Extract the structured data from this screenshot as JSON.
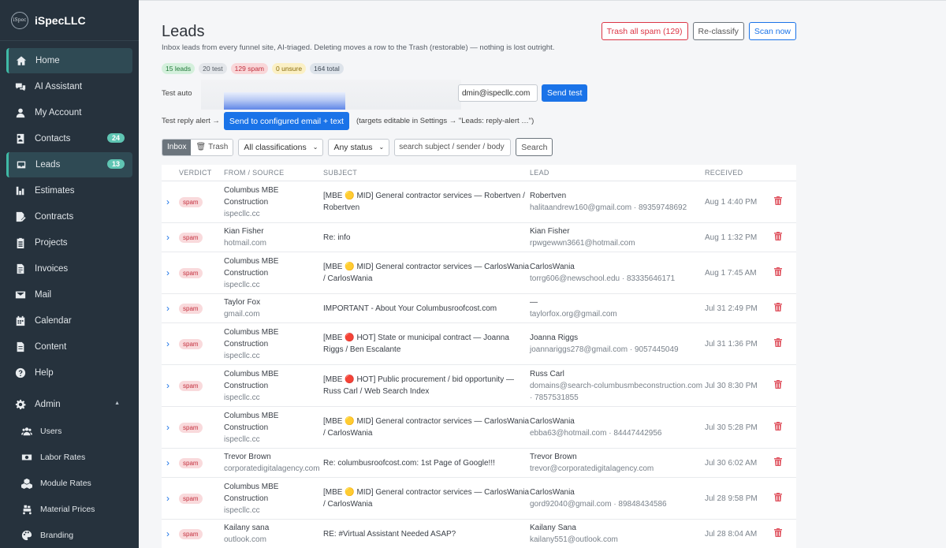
{
  "brand": {
    "logo_text": "iSpec",
    "name": "iSpecLLC"
  },
  "nav": [
    {
      "label": "Home",
      "icon": "home-icon",
      "active": true
    },
    {
      "label": "AI Assistant",
      "icon": "chat-icon"
    },
    {
      "label": "My Account",
      "icon": "user-icon"
    },
    {
      "label": "Contacts",
      "icon": "contacts-icon",
      "badge": "24"
    },
    {
      "label": "Leads",
      "icon": "inbox-icon",
      "badge": "13",
      "active": true
    },
    {
      "label": "Estimates",
      "icon": "estimate-icon"
    },
    {
      "label": "Contracts",
      "icon": "contract-icon"
    },
    {
      "label": "Projects",
      "icon": "clipboard-icon"
    },
    {
      "label": "Invoices",
      "icon": "invoice-icon"
    },
    {
      "label": "Mail",
      "icon": "mail-icon"
    },
    {
      "label": "Calendar",
      "icon": "calendar-icon"
    },
    {
      "label": "Content",
      "icon": "file-icon"
    },
    {
      "label": "Help",
      "icon": "help-icon"
    }
  ],
  "admin": {
    "label": "Admin",
    "caret": "▲",
    "items": [
      {
        "label": "Users",
        "icon": "users-icon"
      },
      {
        "label": "Labor Rates",
        "icon": "money-icon"
      },
      {
        "label": "Module Rates",
        "icon": "cubes-icon"
      },
      {
        "label": "Material Prices",
        "icon": "dolly-icon"
      },
      {
        "label": "Branding",
        "icon": "palette-icon"
      }
    ]
  },
  "page": {
    "title": "Leads",
    "subtitle": "Inbox leads from every funnel site, AI-triaged. Deleting moves a row to the Trash (restorable) — nothing is lost outright.",
    "actions": {
      "trash_spam": "Trash all spam (129)",
      "reclassify": "Re-classify",
      "scan": "Scan now"
    }
  },
  "stats": {
    "leads": "15 leads",
    "test": "20 test",
    "spam": "129 spam",
    "unsure": "0 unsure",
    "total": "164 total"
  },
  "test_auto": {
    "label": "Test auto",
    "email": "dmin@ispecllc.com",
    "send": "Send test"
  },
  "reply_alert": {
    "label": "Test reply alert →",
    "button": "Send to configured email + text",
    "note": "(targets editable in Settings → \"Leads: reply-alert …\")"
  },
  "filters": {
    "inbox": "Inbox",
    "trash": "Trash",
    "classification": "All classifications",
    "status": "Any status",
    "search_placeholder": "search subject / sender / body",
    "search_button": "Search"
  },
  "table": {
    "headers": {
      "verdict": "VERDICT",
      "from": "FROM / SOURCE",
      "subject": "SUBJECT",
      "lead": "LEAD",
      "received": "RECEIVED"
    },
    "rows": [
      {
        "verdict": "spam",
        "from_name": "Columbus MBE Construction",
        "from_src": "ispecllc.cc",
        "subject": "[MBE 🟡 MID] General contractor services — Robertven / Robertven",
        "lead_name": "Robertven",
        "lead_contact": "halitaandrew160@gmail.com · 89359748692",
        "received": "Aug 1 4:40 PM"
      },
      {
        "verdict": "spam",
        "from_name": "Kian Fisher",
        "from_src": "hotmail.com",
        "subject": "Re: info",
        "lead_name": "Kian Fisher",
        "lead_contact": "rpwgewwn3661@hotmail.com",
        "received": "Aug 1 1:32 PM"
      },
      {
        "verdict": "spam",
        "from_name": "Columbus MBE Construction",
        "from_src": "ispecllc.cc",
        "subject": "[MBE 🟡 MID] General contractor services — CarlosWania / CarlosWania",
        "lead_name": "CarlosWania",
        "lead_contact": "torrg606@newschool.edu · 83335646171",
        "received": "Aug 1 7:45 AM"
      },
      {
        "verdict": "spam",
        "from_name": "Taylor Fox",
        "from_src": "gmail.com",
        "subject": "IMPORTANT - About Your Columbusroofcost.com",
        "lead_name": "—",
        "lead_contact": "taylorfox.org@gmail.com",
        "received": "Jul 31 2:49 PM"
      },
      {
        "verdict": "spam",
        "from_name": "Columbus MBE Construction",
        "from_src": "ispecllc.cc",
        "subject": "[MBE 🔴 HOT] State or municipal contract — Joanna Riggs / Ben Escalante",
        "lead_name": "Joanna Riggs",
        "lead_contact": "joannariggs278@gmail.com · 9057445049",
        "received": "Jul 31 1:36 PM"
      },
      {
        "verdict": "spam",
        "from_name": "Columbus MBE Construction",
        "from_src": "ispecllc.cc",
        "subject": "[MBE 🔴 HOT] Public procurement / bid opportunity — Russ Carl / Web Search Index",
        "lead_name": "Russ Carl",
        "lead_contact": "domains@search-columbusmbeconstruction.com · 7857531855",
        "received": "Jul 30 8:30 PM"
      },
      {
        "verdict": "spam",
        "from_name": "Columbus MBE Construction",
        "from_src": "ispecllc.cc",
        "subject": "[MBE 🟡 MID] General contractor services — CarlosWania / CarlosWania",
        "lead_name": "CarlosWania",
        "lead_contact": "ebba63@hotmail.com · 84447442956",
        "received": "Jul 30 5:28 PM"
      },
      {
        "verdict": "spam",
        "from_name": "Trevor Brown",
        "from_src": "corporatedigitalagency.com",
        "subject": "Re: columbusroofcost.com: 1st Page of Google!!!",
        "lead_name": "Trevor Brown",
        "lead_contact": "trevor@corporatedigitalagency.com",
        "received": "Jul 30 6:02 AM"
      },
      {
        "verdict": "spam",
        "from_name": "Columbus MBE Construction",
        "from_src": "ispecllc.cc",
        "subject": "[MBE 🟡 MID] General contractor services — CarlosWania / CarlosWania",
        "lead_name": "CarlosWania",
        "lead_contact": "gord92040@gmail.com · 89848434586",
        "received": "Jul 28 9:58 PM"
      },
      {
        "verdict": "spam",
        "from_name": "Kailany sana",
        "from_src": "outlook.com",
        "subject": "RE: #Virtual Assistant Needed ASAP?",
        "lead_name": "Kailany Sana",
        "lead_contact": "kailany551@outlook.com",
        "received": "Jul 28 8:04 AM"
      }
    ]
  }
}
